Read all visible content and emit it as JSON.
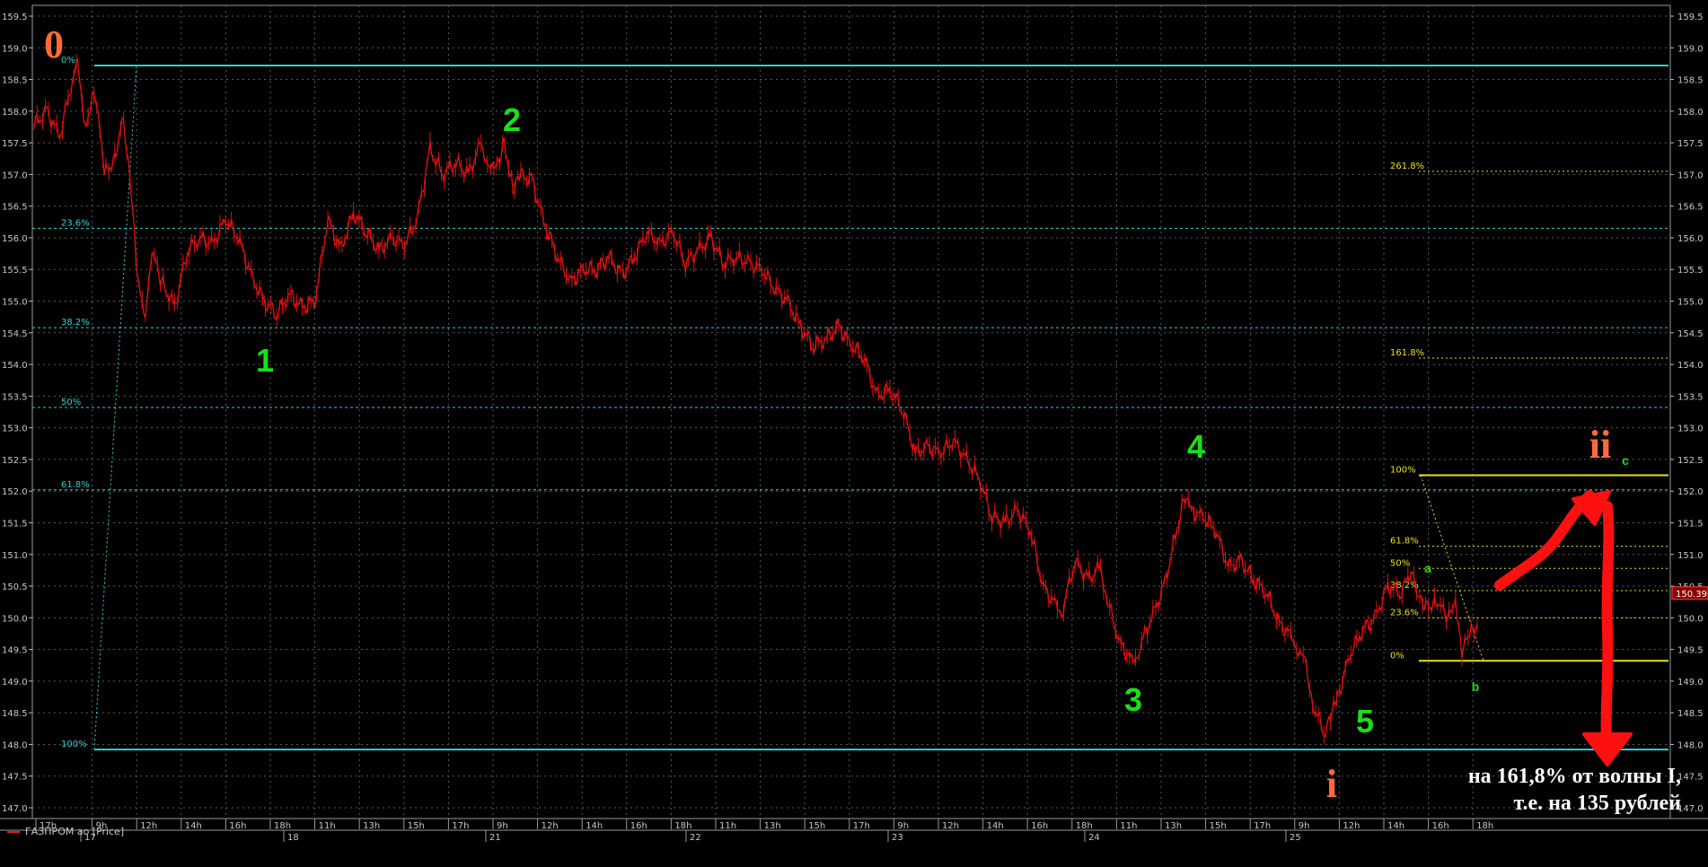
{
  "legend": {
    "series": "ГАЗПРОМ ао [Price]"
  },
  "note": {
    "line1": "на 161,8% от волны I,",
    "line2": "т.е. на 135 рублей"
  },
  "chart_data": {
    "type": "line",
    "colors": {
      "background": "#000000",
      "price": "#e01010",
      "fib_main": "#30d0d8",
      "fib_small": "#e8e020",
      "wave_labels": "#18e018",
      "major_labels": "#ff6a3a",
      "arrows": "#ff1010"
    },
    "grid": true,
    "ylim": [
      146.8,
      159.7
    ],
    "y_ticks": [
      "147.0",
      "147.5",
      "148.0",
      "148.5",
      "149.0",
      "149.5",
      "150.0",
      "150.5",
      "151.0",
      "151.5",
      "152.0",
      "152.5",
      "153.0",
      "153.5",
      "154.0",
      "154.5",
      "155.0",
      "155.5",
      "156.0",
      "156.5",
      "157.0",
      "157.5",
      "158.0",
      "158.5",
      "159.0",
      "159.5"
    ],
    "current_price": "150.39",
    "x_time_labels": [
      "17h",
      "9h",
      "12h",
      "14h",
      "16h",
      "18h",
      "11h",
      "13h",
      "15h",
      "17h",
      "9h",
      "12h",
      "14h",
      "16h",
      "18h",
      "11h",
      "13h",
      "15h",
      "17h",
      "9h",
      "12h",
      "14h",
      "16h",
      "18h",
      "11h",
      "13h",
      "15h",
      "17h",
      "9h",
      "12h",
      "14h",
      "16h",
      "18h"
    ],
    "x_date_labels": [
      "17",
      "18",
      "21",
      "22",
      "23",
      "24",
      "25"
    ],
    "price_path": [
      [
        0,
        157.8
      ],
      [
        10,
        158.0
      ],
      [
        20,
        157.6
      ],
      [
        30,
        158.5
      ],
      [
        34,
        158.7
      ],
      [
        40,
        157.8
      ],
      [
        48,
        158.3
      ],
      [
        55,
        157.0
      ],
      [
        62,
        157.2
      ],
      [
        70,
        157.9
      ],
      [
        75,
        156.9
      ],
      [
        82,
        155.2
      ],
      [
        87,
        154.8
      ],
      [
        92,
        155.8
      ],
      [
        100,
        155.3
      ],
      [
        110,
        154.9
      ],
      [
        120,
        155.8
      ],
      [
        130,
        156.0
      ],
      [
        140,
        155.9
      ],
      [
        150,
        156.3
      ],
      [
        160,
        156.0
      ],
      [
        170,
        155.4
      ],
      [
        180,
        155.0
      ],
      [
        190,
        154.8
      ],
      [
        200,
        155.1
      ],
      [
        210,
        154.9
      ],
      [
        220,
        155.0
      ],
      [
        230,
        156.3
      ],
      [
        240,
        155.8
      ],
      [
        250,
        156.4
      ],
      [
        260,
        156.1
      ],
      [
        270,
        155.8
      ],
      [
        280,
        156.0
      ],
      [
        290,
        155.9
      ],
      [
        300,
        156.3
      ],
      [
        310,
        157.4
      ],
      [
        320,
        157.0
      ],
      [
        330,
        157.2
      ],
      [
        340,
        157.0
      ],
      [
        350,
        157.5
      ],
      [
        355,
        157.2
      ],
      [
        360,
        157.0
      ],
      [
        368,
        157.5
      ],
      [
        375,
        156.8
      ],
      [
        380,
        157.0
      ],
      [
        390,
        156.9
      ],
      [
        400,
        156.2
      ],
      [
        410,
        155.7
      ],
      [
        420,
        155.3
      ],
      [
        430,
        155.5
      ],
      [
        440,
        155.5
      ],
      [
        450,
        155.7
      ],
      [
        460,
        155.4
      ],
      [
        470,
        155.7
      ],
      [
        480,
        156.1
      ],
      [
        490,
        155.9
      ],
      [
        500,
        156.1
      ],
      [
        510,
        155.6
      ],
      [
        520,
        155.8
      ],
      [
        530,
        156.0
      ],
      [
        540,
        155.6
      ],
      [
        550,
        155.7
      ],
      [
        560,
        155.6
      ],
      [
        570,
        155.5
      ],
      [
        580,
        155.2
      ],
      [
        590,
        155.0
      ],
      [
        600,
        154.6
      ],
      [
        610,
        154.3
      ],
      [
        620,
        154.4
      ],
      [
        630,
        154.6
      ],
      [
        640,
        154.3
      ],
      [
        650,
        154.1
      ],
      [
        660,
        153.5
      ],
      [
        670,
        153.6
      ],
      [
        680,
        153.3
      ],
      [
        690,
        152.6
      ],
      [
        700,
        152.7
      ],
      [
        710,
        152.6
      ],
      [
        720,
        152.8
      ],
      [
        730,
        152.5
      ],
      [
        740,
        152.2
      ],
      [
        750,
        151.6
      ],
      [
        760,
        151.5
      ],
      [
        770,
        151.7
      ],
      [
        780,
        151.4
      ],
      [
        790,
        150.5
      ],
      [
        800,
        150.2
      ],
      [
        805,
        150.1
      ],
      [
        815,
        150.9
      ],
      [
        825,
        150.6
      ],
      [
        835,
        150.8
      ],
      [
        840,
        150.3
      ],
      [
        850,
        149.6
      ],
      [
        860,
        149.3
      ],
      [
        865,
        149.5
      ],
      [
        875,
        150.0
      ],
      [
        885,
        150.5
      ],
      [
        895,
        151.4
      ],
      [
        900,
        151.9
      ],
      [
        905,
        151.7
      ],
      [
        915,
        151.6
      ],
      [
        925,
        151.4
      ],
      [
        935,
        150.8
      ],
      [
        945,
        150.9
      ],
      [
        955,
        150.6
      ],
      [
        965,
        150.4
      ],
      [
        975,
        149.9
      ],
      [
        985,
        149.7
      ],
      [
        990,
        149.5
      ],
      [
        995,
        149.3
      ],
      [
        1000,
        148.7
      ],
      [
        1010,
        148.2
      ],
      [
        1015,
        148.4
      ],
      [
        1020,
        148.7
      ],
      [
        1030,
        149.4
      ],
      [
        1040,
        149.8
      ],
      [
        1050,
        150.0
      ],
      [
        1060,
        150.5
      ],
      [
        1070,
        150.4
      ],
      [
        1078,
        150.7
      ],
      [
        1085,
        150.3
      ],
      [
        1092,
        150.2
      ],
      [
        1100,
        150.2
      ],
      [
        1108,
        150.0
      ],
      [
        1113,
        150.3
      ],
      [
        1118,
        149.5
      ],
      [
        1124,
        149.7
      ],
      [
        1130,
        149.9
      ]
    ],
    "fib_main": [
      {
        "label": "0%",
        "value": 158.72
      },
      {
        "label": "23.6%",
        "value": 156.15
      },
      {
        "label": "38.2%",
        "value": 154.58
      },
      {
        "label": "50%",
        "value": 153.32
      },
      {
        "label": "61.8%",
        "value": 152.02
      },
      {
        "label": "100%",
        "value": 147.92
      }
    ],
    "fib_small": [
      {
        "label": "261.8%",
        "value": 157.05
      },
      {
        "label": "161.8%",
        "value": 154.1
      },
      {
        "label": "100%",
        "value": 152.25
      },
      {
        "label": "61.8%",
        "value": 151.13
      },
      {
        "label": "50%",
        "value": 150.78
      },
      {
        "label": "38.2%",
        "value": 150.43
      },
      {
        "label": "23.6%",
        "value": 150.0
      },
      {
        "label": "0%",
        "value": 149.32
      }
    ],
    "wave_labels": [
      "0",
      "1",
      "2",
      "3",
      "4",
      "5",
      "i",
      "ii",
      "c",
      "a",
      "b"
    ]
  }
}
